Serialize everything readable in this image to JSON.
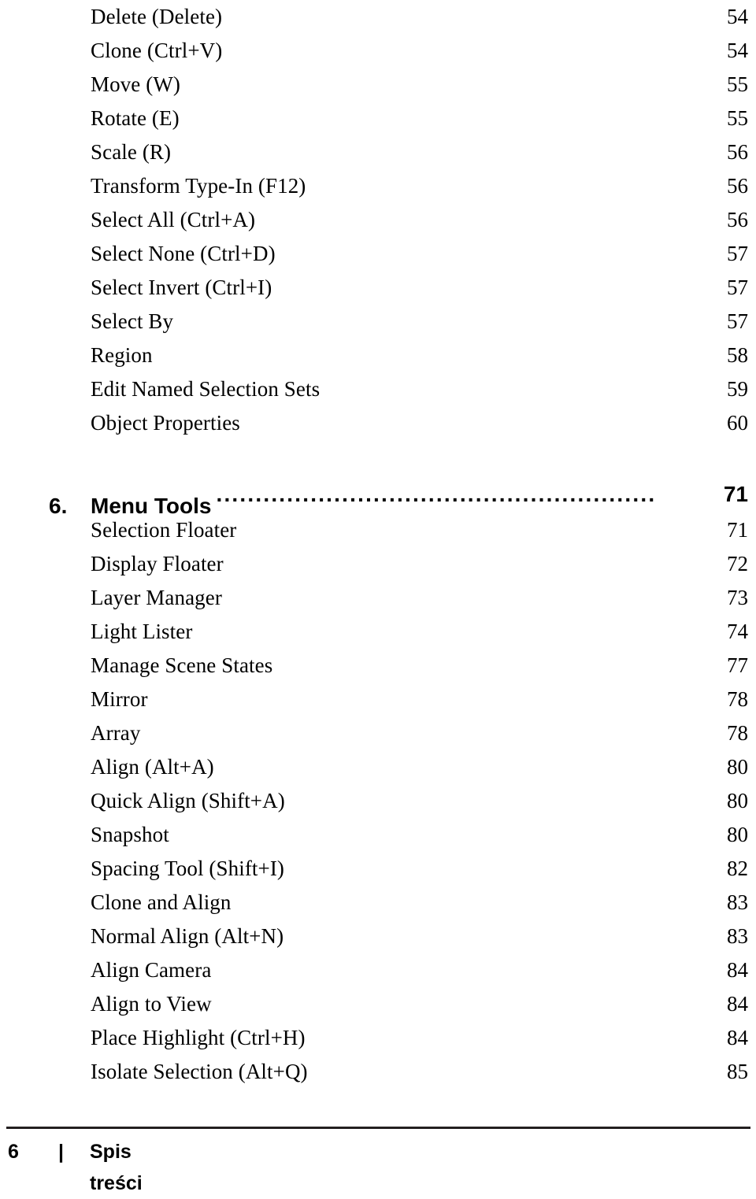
{
  "page": {
    "background_color": "#ffffff",
    "text_color": "#000000",
    "rule_color": "#231f20"
  },
  "toc": {
    "entries": [
      {
        "label": "Delete (Delete)",
        "page": "54",
        "type": "entry"
      },
      {
        "label": "Clone (Ctrl+V)",
        "page": "54",
        "type": "entry"
      },
      {
        "label": "Move (W)",
        "page": "55",
        "type": "entry"
      },
      {
        "label": "Rotate (E)",
        "page": "55",
        "type": "entry"
      },
      {
        "label": "Scale (R)",
        "page": "56",
        "type": "entry"
      },
      {
        "label": "Transform Type-In (F12)",
        "page": "56",
        "type": "entry"
      },
      {
        "label": "Select All (Ctrl+A)",
        "page": "56",
        "type": "entry"
      },
      {
        "label": "Select None (Ctrl+D)",
        "page": "57",
        "type": "entry"
      },
      {
        "label": "Select Invert (Ctrl+I)",
        "page": "57",
        "type": "entry"
      },
      {
        "label": "Select By",
        "page": "57",
        "type": "entry"
      },
      {
        "label": "Region",
        "page": "58",
        "type": "entry"
      },
      {
        "label": "Edit Named Selection Sets",
        "page": "59",
        "type": "entry"
      },
      {
        "label": "Object Properties",
        "page": "60",
        "type": "entry"
      },
      {
        "number": "6.",
        "label": "Menu Tools",
        "leader": "..........................................................................",
        "page": "71",
        "type": "section"
      },
      {
        "label": "Selection Floater",
        "page": "71",
        "type": "entry"
      },
      {
        "label": "Display Floater",
        "page": "72",
        "type": "entry"
      },
      {
        "label": "Layer Manager",
        "page": "73",
        "type": "entry"
      },
      {
        "label": "Light Lister",
        "page": "74",
        "type": "entry"
      },
      {
        "label": "Manage Scene States",
        "page": "77",
        "type": "entry"
      },
      {
        "label": "Mirror",
        "page": "78",
        "type": "entry"
      },
      {
        "label": "Array",
        "page": "78",
        "type": "entry"
      },
      {
        "label": "Align (Alt+A)",
        "page": "80",
        "type": "entry"
      },
      {
        "label": "Quick Align (Shift+A)",
        "page": "80",
        "type": "entry"
      },
      {
        "label": "Snapshot",
        "page": "80",
        "type": "entry"
      },
      {
        "label": "Spacing Tool (Shift+I)",
        "page": "82",
        "type": "entry"
      },
      {
        "label": "Clone and Align",
        "page": "83",
        "type": "entry"
      },
      {
        "label": "Normal Align (Alt+N)",
        "page": "83",
        "type": "entry"
      },
      {
        "label": "Align Camera",
        "page": "84",
        "type": "entry"
      },
      {
        "label": "Align to View",
        "page": "84",
        "type": "entry"
      },
      {
        "label": "Place Highlight (Ctrl+H)",
        "page": "84",
        "type": "entry"
      },
      {
        "label": "Isolate Selection (Alt+Q)",
        "page": "85",
        "type": "entry"
      }
    ]
  },
  "footer": {
    "page_number": "6",
    "separator": "|",
    "title": "Spis treści"
  }
}
